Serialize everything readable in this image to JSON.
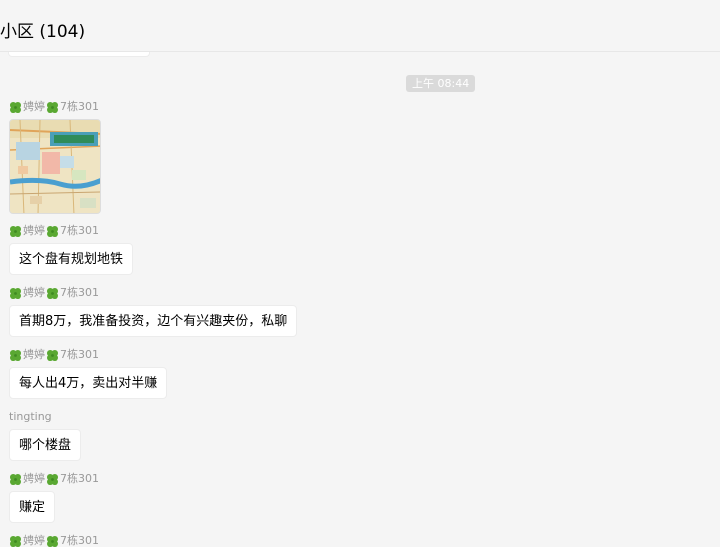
{
  "header": {
    "title": "小区 (104)"
  },
  "timestamp": "上午 08:44",
  "messages": [
    {
      "sender_a": "娉婷",
      "sender_b": "7栋301",
      "type": "image",
      "image": "map-thumbnail"
    },
    {
      "sender_a": "娉婷",
      "sender_b": "7栋301",
      "type": "text",
      "text": "这个盘有规划地铁"
    },
    {
      "sender_a": "娉婷",
      "sender_b": "7栋301",
      "type": "text",
      "text": "首期8万，我准备投资，边个有兴趣夹份，私聊"
    },
    {
      "sender_a": "娉婷",
      "sender_b": "7栋301",
      "type": "text",
      "text": "每人出4万，卖出对半赚"
    },
    {
      "sender_plain": "tingting",
      "type": "text",
      "text": "哪个楼盘"
    },
    {
      "sender_a": "娉婷",
      "sender_b": "7栋301",
      "type": "text",
      "text": "赚定"
    },
    {
      "sender_a": "娉婷",
      "sender_b": "7栋301",
      "type": "partial"
    }
  ],
  "colors": {
    "background": "#f5f5f5",
    "bubble": "#ffffff",
    "sender_text": "#999999",
    "timestamp_bg": "#dadada",
    "clover": "#5aa832"
  },
  "icons": [
    "clover-icon"
  ]
}
